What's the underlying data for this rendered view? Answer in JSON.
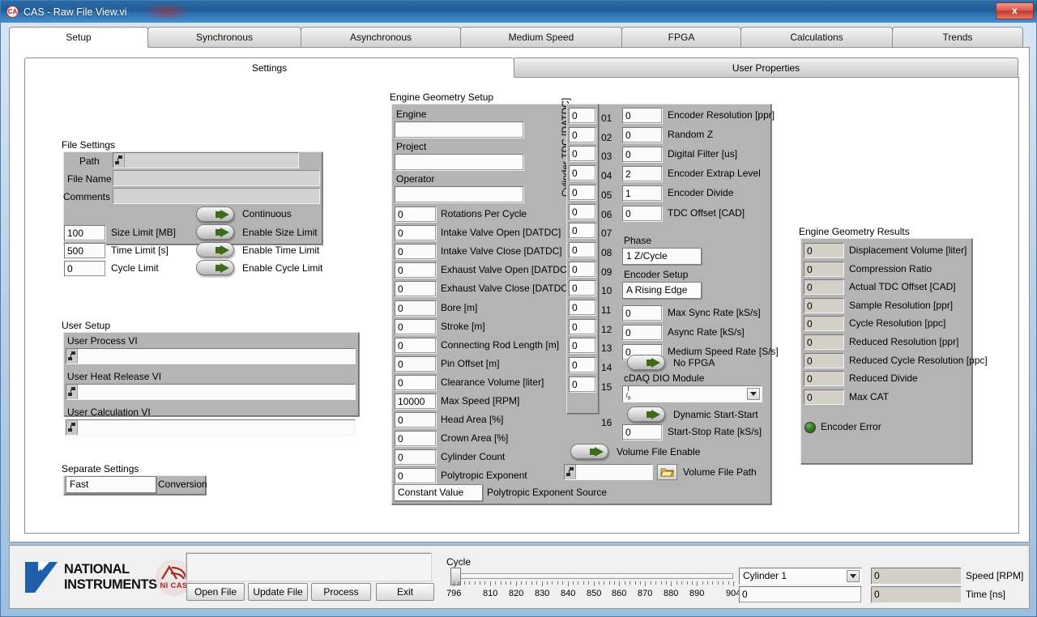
{
  "window": {
    "title": "CAS - Raw File View.vi",
    "app_icon_text": "CA",
    "close_label": "x"
  },
  "tabs": [
    {
      "label": "Setup",
      "active": true
    },
    {
      "label": "Synchronous",
      "active": false
    },
    {
      "label": "Asynchronous",
      "active": false
    },
    {
      "label": "Medium Speed",
      "active": false
    },
    {
      "label": "FPGA",
      "active": false
    },
    {
      "label": "Calculations",
      "active": false
    },
    {
      "label": "Trends",
      "active": false
    }
  ],
  "subtabs": [
    {
      "label": "Settings",
      "active": true
    },
    {
      "label": "User Properties",
      "active": false
    }
  ],
  "file_settings": {
    "title": "File Settings",
    "path_label": "Path",
    "path_value": "",
    "file_name_label": "File Name",
    "file_name_value": "",
    "comments_label": "Comments",
    "comments_value": "",
    "size_limit_value": "100",
    "size_limit_label": "Size Limit [MB]",
    "time_limit_value": "500",
    "time_limit_label": "Time Limit [s]",
    "cycle_limit_value": "0",
    "cycle_limit_label": "Cycle Limit",
    "continuous_label": "Continuous",
    "enable_size_limit_label": "Enable Size Limit",
    "enable_time_limit_label": "Enable Time Limit",
    "enable_cycle_limit_label": "Enable Cycle Limit"
  },
  "user_setup": {
    "title": "User Setup",
    "process_vi_label": "User Process VI",
    "process_vi_value": "",
    "heat_release_vi_label": "User Heat Release VI",
    "heat_release_vi_value": "",
    "calculation_vi_label": "User Calculation VI",
    "calculation_vi_value": ""
  },
  "separate_settings": {
    "title": "Separate Settings",
    "conversion_value": "Fast",
    "conversion_label": "Conversion"
  },
  "engine_geometry": {
    "title": "Engine Geometry Setup",
    "engine_label": "Engine",
    "engine_value": "",
    "project_label": "Project",
    "project_value": "",
    "operator_label": "Operator",
    "operator_value": "",
    "fields": [
      {
        "value": "0",
        "label": "Rotations Per Cycle"
      },
      {
        "value": "0",
        "label": "Intake Valve Open [DATDC]"
      },
      {
        "value": "0",
        "label": "Intake Valve Close [DATDC]"
      },
      {
        "value": "0",
        "label": "Exhaust Valve Open [DATDC]"
      },
      {
        "value": "0",
        "label": "Exhaust Valve Close [DATDC]"
      },
      {
        "value": "0",
        "label": "Bore [m]"
      },
      {
        "value": "0",
        "label": "Stroke [m]"
      },
      {
        "value": "0",
        "label": "Connecting Rod Length [m]"
      },
      {
        "value": "0",
        "label": "Pin Offset [m]"
      },
      {
        "value": "0",
        "label": "Clearance Volume [liter]"
      },
      {
        "value": "10000",
        "label": "Max Speed [RPM]"
      },
      {
        "value": "0",
        "label": "Head Area [%]"
      },
      {
        "value": "0",
        "label": "Crown Area [%]"
      },
      {
        "value": "0",
        "label": "Cylinder Count"
      },
      {
        "value": "0",
        "label": "Polytropic Exponent"
      }
    ],
    "polytropic_source_value": "Constant Value",
    "polytropic_source_label": "Polytropic Exponent Source"
  },
  "cylinder_tdc": {
    "axis_label": "Cylinder TDC [DATDC]",
    "rows": [
      {
        "index": "01",
        "value": "0"
      },
      {
        "index": "02",
        "value": "0"
      },
      {
        "index": "03",
        "value": "0"
      },
      {
        "index": "04",
        "value": "0"
      },
      {
        "index": "05",
        "value": "0"
      },
      {
        "index": "06",
        "value": "0"
      },
      {
        "index": "07",
        "value": "0"
      },
      {
        "index": "08",
        "value": "0"
      },
      {
        "index": "09",
        "value": "0"
      },
      {
        "index": "10",
        "value": "0"
      },
      {
        "index": "11",
        "value": "0"
      },
      {
        "index": "12",
        "value": "0"
      },
      {
        "index": "13",
        "value": "0"
      },
      {
        "index": "14",
        "value": "0"
      },
      {
        "index": "15",
        "value": "0"
      }
    ],
    "last_index": "16"
  },
  "encoder": {
    "fields": [
      {
        "value": "0",
        "label": "Encoder Resolution [ppr]"
      },
      {
        "value": "0",
        "label": "Random Z"
      },
      {
        "value": "0",
        "label": "Digital Filter [us]"
      },
      {
        "value": "2",
        "label": "Encoder Extrap Level"
      },
      {
        "value": "1",
        "label": "Encoder Divide"
      },
      {
        "value": "0",
        "label": "TDC Offset [CAD]"
      }
    ],
    "phase_label": "Phase",
    "phase_value": "1 Z/Cycle",
    "encoder_setup_label": "Encoder Setup",
    "encoder_setup_value": "A Rising Edge",
    "rate_fields": [
      {
        "value": "0",
        "label": "Max Sync Rate [kS/s]"
      },
      {
        "value": "0",
        "label": "Async Rate [kS/s]"
      },
      {
        "value": "0",
        "label": "Medium Speed Rate [S/s]"
      }
    ],
    "no_fpga_label": "No FPGA",
    "cdaq_dio_label": "cDAQ DIO Module",
    "cdaq_dio_value": "",
    "dynamic_start_label": "Dynamic Start-Start",
    "start_stop_rate_value": "0",
    "start_stop_rate_label": "Start-Stop Rate [kS/s]",
    "volume_file_enable_label": "Volume File Enable",
    "volume_file_path_value": "",
    "volume_file_path_label": "Volume File Path"
  },
  "results": {
    "title": "Engine Geometry Results",
    "rows": [
      {
        "value": "0",
        "label": "Displacement Volume [liter]"
      },
      {
        "value": "0",
        "label": "Compression Ratio"
      },
      {
        "value": "0",
        "label": "Actual TDC Offset [CAD]"
      },
      {
        "value": "0",
        "label": "Sample Resolution [ppr]"
      },
      {
        "value": "0",
        "label": "Cycle Resolution [ppc]"
      },
      {
        "value": "0",
        "label": "Reduced Resolution [ppr]"
      },
      {
        "value": "0",
        "label": "Reduced Cycle Resolution [ppc]"
      },
      {
        "value": "0",
        "label": "Reduced Divide"
      },
      {
        "value": "0",
        "label": "Max CAT"
      }
    ],
    "encoder_error_label": "Encoder Error"
  },
  "footer": {
    "logo_line1": "NATIONAL",
    "logo_line2": "INSTRUMENTS",
    "logo_cas": "NI CAS",
    "status_value": "",
    "buttons": [
      {
        "label": "Open File"
      },
      {
        "label": "Update File"
      },
      {
        "label": "Process"
      },
      {
        "label": "Exit"
      }
    ],
    "cycle_label": "Cycle",
    "cycle_value": "0",
    "cycle_ticks": [
      "796",
      "810",
      "820",
      "830",
      "840",
      "850",
      "860",
      "870",
      "880",
      "890",
      "904"
    ],
    "cycle_min": 796,
    "cycle_max": 904,
    "cylinder_value": "Cylinder 1",
    "speed_value": "0",
    "speed_label": "Speed [RPM]",
    "time_value": "0",
    "time_label": "Time [ns]"
  }
}
